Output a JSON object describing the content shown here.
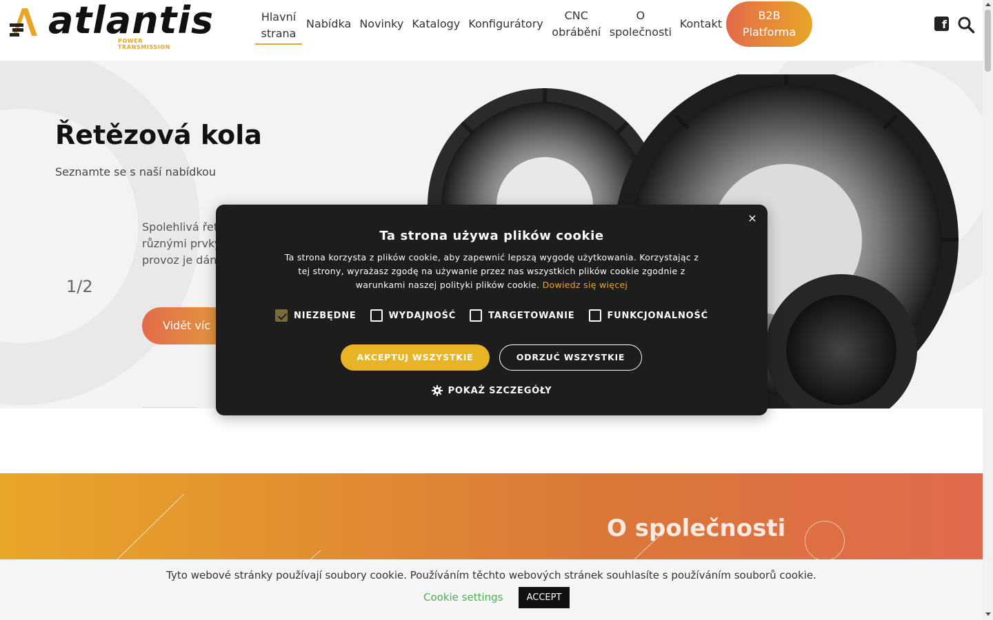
{
  "brand": {
    "name": "atlantis",
    "tagline": "POWER TRANSMISSION",
    "accent_color": "#e8a628",
    "secondary_color": "#e26a4a"
  },
  "nav": {
    "items": [
      {
        "label": "Hlavní strana",
        "active": true
      },
      {
        "label": "Nabídka"
      },
      {
        "label": "Novinky"
      },
      {
        "label": "Katalogy"
      },
      {
        "label": "Konfigurátory"
      },
      {
        "label": "CNC obrábění"
      },
      {
        "label": "O společnosti"
      },
      {
        "label": "Kontakt"
      }
    ],
    "b2b_line1": "B2B",
    "b2b_line2": "Platforma",
    "facebook_icon": "facebook-icon",
    "search_icon": "search-icon"
  },
  "hero": {
    "title": "Řetězová kola",
    "subtitle": "Seznamte se s naší nabídkou",
    "body_line1": "Spolehlivá řet",
    "body_line2": "různými prvky",
    "body_line3": "provoz je dán",
    "counter": "1/2",
    "cta": "Vidět víc"
  },
  "band": {
    "title": "O společnosti"
  },
  "cookie_modal": {
    "title": "Ta strona używa plików cookie",
    "description": "Ta strona korzysta z plików cookie, aby zapewnić lepszą wygodę użytkowania. Korzystając z tej strony, wyrażasz zgodę na używanie przez nas wszystkich plików cookie zgodnie z warunkami naszej polityki plików cookie.",
    "link": "Dowiedz się więcej",
    "options": [
      {
        "label": "NIEZBĘDNE",
        "checked": true
      },
      {
        "label": "WYDAJNOŚĆ",
        "checked": false
      },
      {
        "label": "TARGETOWANIE",
        "checked": false
      },
      {
        "label": "FUNKCJONALNOŚĆ",
        "checked": false
      }
    ],
    "accept_all": "AKCEPTUJ WSZYSTKIE",
    "reject_all": "ODRZUĆ WSZYSTKIE",
    "details": "POKAŻ SZCZEGÓŁY",
    "close_symbol": "×"
  },
  "cookie_bar": {
    "text": "Tyto webové stránky používají soubory cookie. Používáním těchto webových stránek souhlasíte s používáním souborů cookie.",
    "settings": "Cookie settings",
    "accept": "ACCEPT"
  }
}
